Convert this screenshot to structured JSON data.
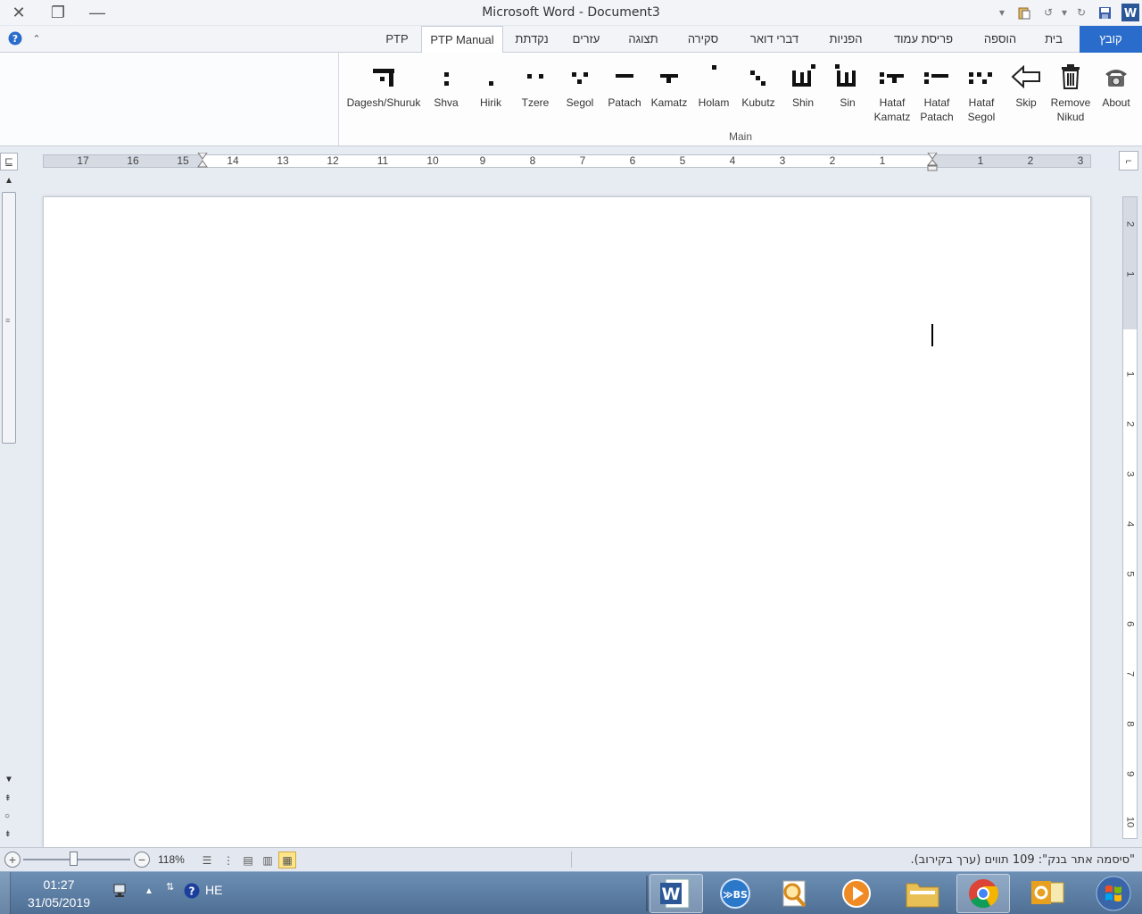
{
  "window": {
    "title": "Microsoft Word - Document3"
  },
  "tabs": [
    {
      "label": "PTP"
    },
    {
      "label": "PTP Manual"
    },
    {
      "label": "נקדתת"
    },
    {
      "label": "עזרים"
    },
    {
      "label": "תצוגה"
    },
    {
      "label": "סקירה"
    },
    {
      "label": "דברי דואר"
    },
    {
      "label": "הפניות"
    },
    {
      "label": "פריסת עמוד"
    },
    {
      "label": "הוספה"
    },
    {
      "label": "בית"
    },
    {
      "label": "קובץ"
    }
  ],
  "ribbon": {
    "group_label": "Main",
    "buttons": [
      {
        "label": "Dagesh/Shuruk",
        "icon": "dagesh-icon"
      },
      {
        "label": "Shva",
        "icon": "shva-icon"
      },
      {
        "label": "Hirik",
        "icon": "hirik-icon"
      },
      {
        "label": "Tzere",
        "icon": "tzere-icon"
      },
      {
        "label": "Segol",
        "icon": "segol-icon"
      },
      {
        "label": "Patach",
        "icon": "patach-icon"
      },
      {
        "label": "Kamatz",
        "icon": "kamatz-icon"
      },
      {
        "label": "Holam",
        "icon": "holam-icon"
      },
      {
        "label": "Kubutz",
        "icon": "kubutz-icon"
      },
      {
        "label": "Shin",
        "icon": "shin-icon"
      },
      {
        "label": "Sin",
        "icon": "sin-icon"
      },
      {
        "label": "Hataf",
        "label2": "Kamatz",
        "icon": "hataf-kamatz-icon"
      },
      {
        "label": "Hataf",
        "label2": "Patach",
        "icon": "hataf-patach-icon"
      },
      {
        "label": "Hataf",
        "label2": "Segol",
        "icon": "hataf-segol-icon"
      },
      {
        "label": "Skip",
        "icon": "skip-arrow-icon"
      },
      {
        "label": "Remove",
        "label2": "Nikud",
        "icon": "trash-icon"
      },
      {
        "label": "About",
        "icon": "telephone-icon"
      }
    ]
  },
  "ruler": {
    "numbers_left": [
      "17",
      "16",
      "15",
      "14",
      "13",
      "12",
      "11",
      "10",
      "9",
      "8",
      "7",
      "6",
      "5",
      "4",
      "3",
      "2",
      "1"
    ],
    "numbers_right": [
      "1",
      "2",
      "3"
    ],
    "vertical_numbers": [
      "2",
      "1",
      "1",
      "2",
      "3",
      "4",
      "5",
      "6",
      "7",
      "8",
      "9",
      "10"
    ]
  },
  "statusbar": {
    "word_count_text": "\"סיסמה אתר בנק\": 109 תווים (ערך בקירוב).",
    "zoom_percent": "118%",
    "zoom_level": 0.47
  },
  "taskbar": {
    "time": "01:27",
    "date": "31/05/2019",
    "language": "HE",
    "apps": [
      {
        "icon": "word-icon",
        "active": true
      },
      {
        "icon": "bs-icon",
        "active": false
      },
      {
        "icon": "magnifier-icon",
        "active": false
      },
      {
        "icon": "media-player-icon",
        "active": false
      },
      {
        "icon": "folder-icon",
        "active": false
      },
      {
        "icon": "chrome-icon",
        "active": true
      },
      {
        "icon": "outlook-icon",
        "active": false
      }
    ]
  },
  "colors": {
    "file_tab": "#2a6ccb",
    "taskbar": "#5b7ea6",
    "active_view": "#fde58a"
  }
}
